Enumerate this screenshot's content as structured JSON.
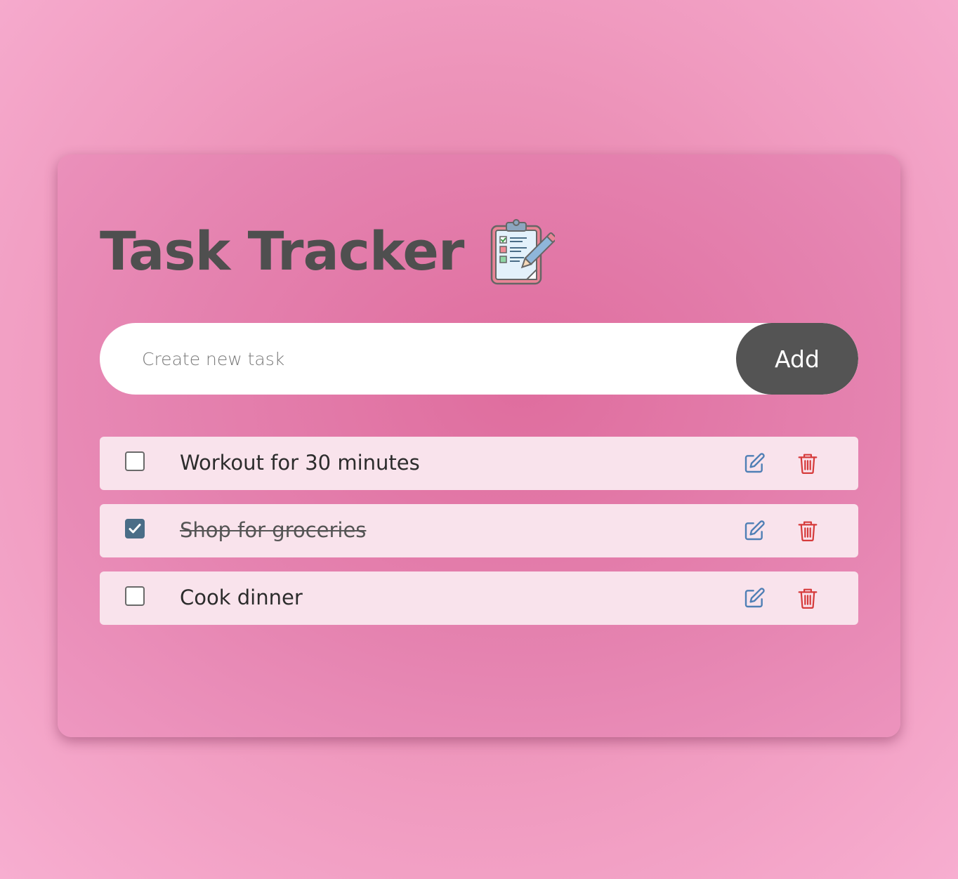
{
  "app": {
    "title": "Task Tracker",
    "title_icon": "clipboard-checklist-icon"
  },
  "new_task": {
    "placeholder": "Create new task",
    "value": "",
    "add_label": "Add"
  },
  "tasks": [
    {
      "text": "Workout for 30 minutes",
      "completed": false
    },
    {
      "text": "Shop for groceries",
      "completed": true
    },
    {
      "text": "Cook dinner",
      "completed": false
    }
  ],
  "icons": {
    "edit": "pencil-square-icon",
    "delete": "trash-icon"
  },
  "colors": {
    "edit_icon": "#4f7fb5",
    "delete_icon": "#d63b3b",
    "checkbox_checked": "#4a6d87",
    "add_button": "#545454",
    "task_background": "#f9e3ec"
  }
}
